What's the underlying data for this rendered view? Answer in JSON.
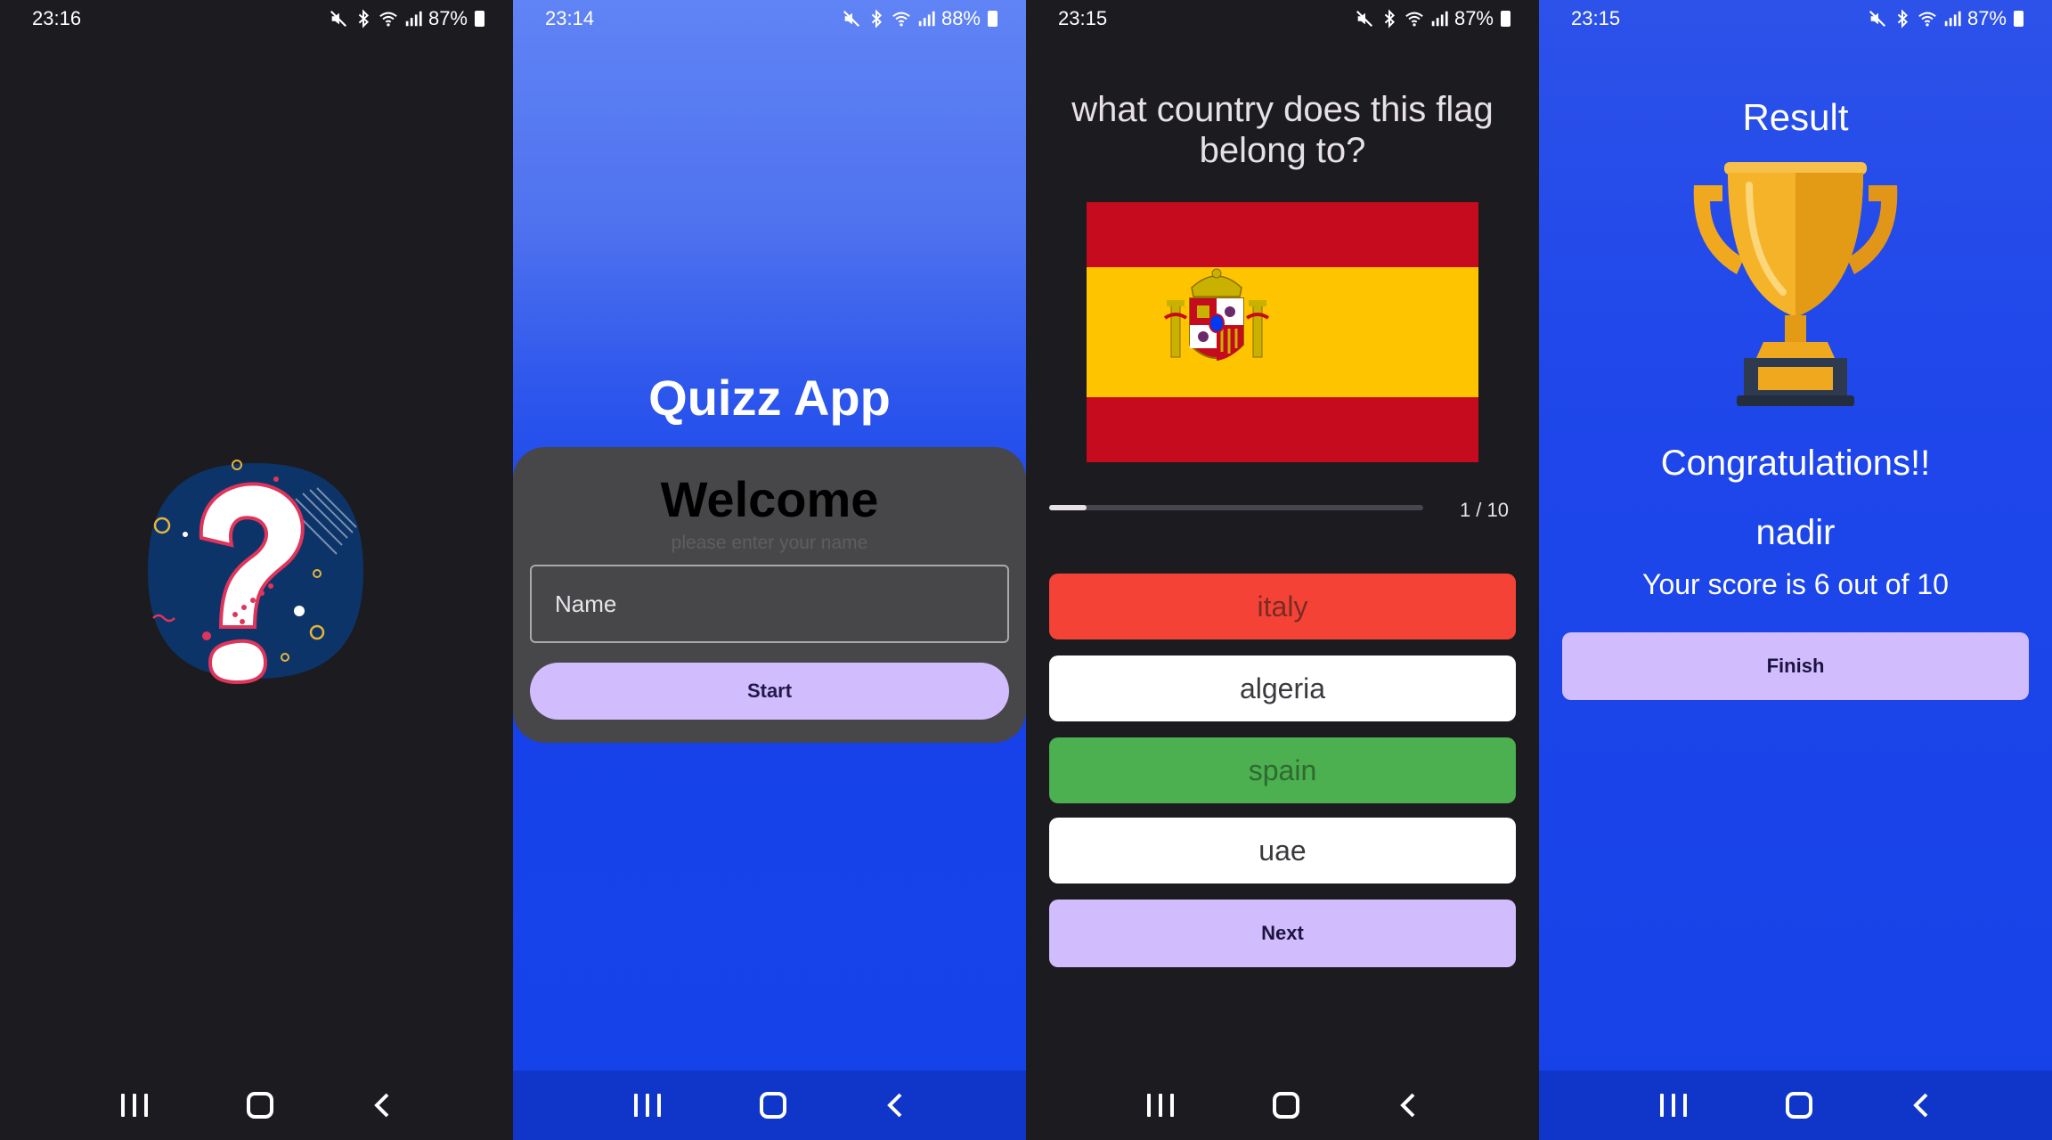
{
  "screens": [
    {
      "status": {
        "time": "23:16",
        "battery": "87%"
      }
    },
    {
      "status": {
        "time": "23:14",
        "battery": "88%"
      },
      "app_title": "Quizz App",
      "welcome": {
        "title": "Welcome",
        "subtitle": "please enter your name",
        "name_placeholder": "Name",
        "start_label": "Start"
      }
    },
    {
      "status": {
        "time": "23:15",
        "battery": "87%"
      },
      "question": "what country does this flag belong to?",
      "flag_icon": "spain-flag",
      "progress": {
        "current": 1,
        "total": 10,
        "text": "1 / 10"
      },
      "options": [
        {
          "label": "italy",
          "state": "wrong"
        },
        {
          "label": "algeria",
          "state": "neutral"
        },
        {
          "label": "spain",
          "state": "correct"
        },
        {
          "label": "uae",
          "state": "neutral"
        }
      ],
      "next_label": "Next"
    },
    {
      "status": {
        "time": "23:15",
        "battery": "87%"
      },
      "result_title": "Result",
      "congrats": "Congratulations!!",
      "player_name": "nadir",
      "score_text": "Your score is 6 out of 10",
      "finish_label": "Finish"
    }
  ],
  "colors": {
    "dark_bg": "#1c1b1f",
    "blue_bg": "#1643e9",
    "accent_button": "#d1bcfd",
    "wrong": "#f44336",
    "correct": "#4caf50",
    "spain_red": "#c60b1e",
    "spain_yellow": "#ffc400"
  },
  "icons": [
    "mute-icon",
    "bluetooth-icon",
    "wifi-icon",
    "signal-icon",
    "battery-icon",
    "question-mark-logo",
    "trophy-icon",
    "recents-icon",
    "home-icon",
    "back-icon"
  ]
}
